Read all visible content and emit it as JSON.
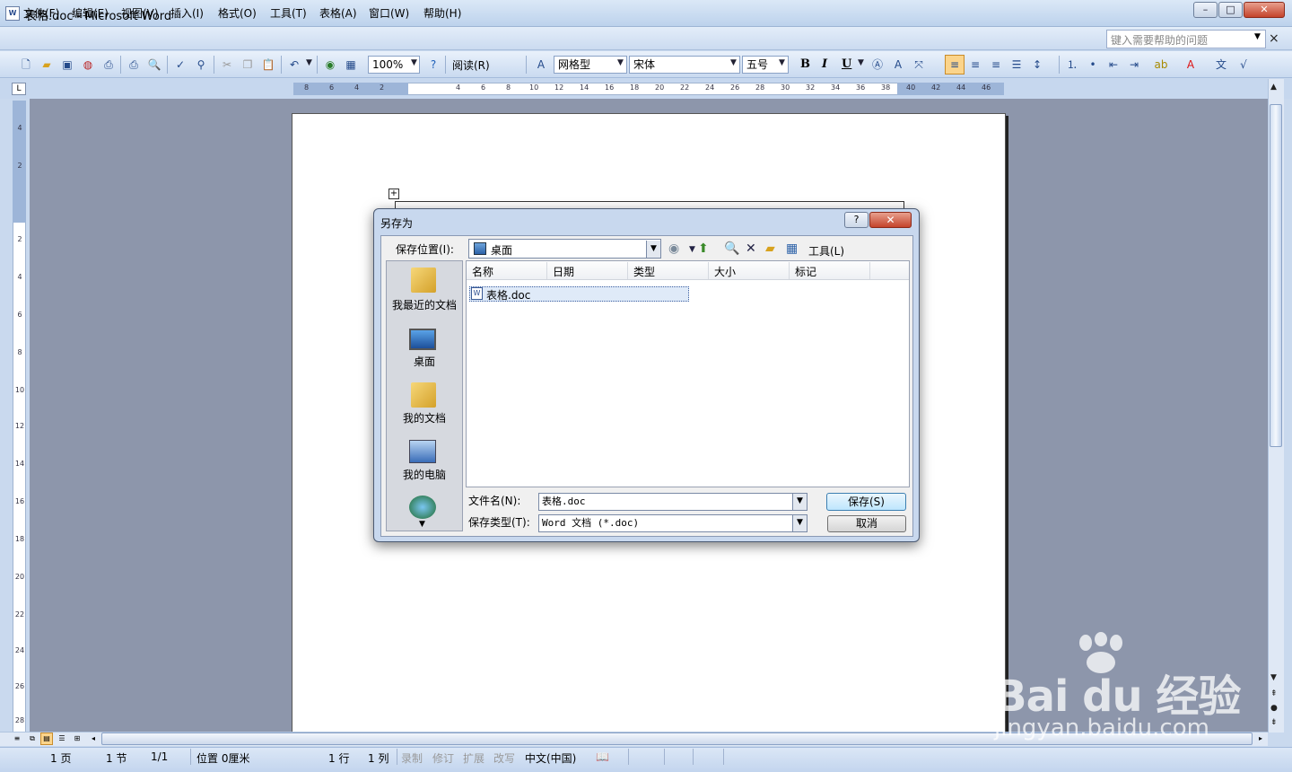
{
  "window": {
    "title": "表格.doc - Microsoft Word",
    "icon": "word-doc-icon",
    "minimize": "–",
    "maximize": "□",
    "close": "✕"
  },
  "menu": {
    "items": [
      "文件(F)",
      "编辑(E)",
      "视图(V)",
      "插入(I)",
      "格式(O)",
      "工具(T)",
      "表格(A)",
      "窗口(W)",
      "帮助(H)"
    ],
    "help_placeholder": "键入需要帮助的问题",
    "close": "×"
  },
  "toolbar": {
    "zoom": "100%",
    "read": "阅读(R)",
    "style": "网格型",
    "font": "宋体",
    "size": "五号",
    "bold": "B",
    "italic": "I",
    "underline": "U"
  },
  "ruler": {
    "h_ticks": [
      "8",
      "6",
      "4",
      "2",
      "",
      "2",
      "4",
      "6",
      "8",
      "10",
      "12",
      "14",
      "16",
      "18",
      "20",
      "22",
      "24",
      "26",
      "28",
      "30",
      "32",
      "34",
      "36",
      "38",
      "40",
      "42",
      "44",
      "46"
    ],
    "v_ticks": [
      "4",
      "2",
      "",
      "2",
      "4",
      "6",
      "8",
      "10",
      "12",
      "14",
      "16",
      "18",
      "20",
      "22",
      "24",
      "26",
      "28"
    ]
  },
  "dialog": {
    "title": "另存为",
    "help": "?",
    "close": "✕",
    "save_in_label": "保存位置(I):",
    "save_in_value": "桌面",
    "tools": "工具(L)",
    "places": [
      "我最近的文档",
      "桌面",
      "我的文档",
      "我的电脑"
    ],
    "columns": [
      "名称",
      "日期",
      "类型",
      "大小",
      "标记"
    ],
    "files": [
      {
        "name": "表格.doc"
      }
    ],
    "filename_label": "文件名(N):",
    "filename_value": "表格.doc",
    "filetype_label": "保存类型(T):",
    "filetype_value": "Word 文档 (*.doc)",
    "save_button": "保存(S)",
    "cancel_button": "取消"
  },
  "status": {
    "page": "1 页",
    "section": "1 节",
    "pages": "1/1",
    "position": "位置 0厘米",
    "line": "1 行",
    "column": "1 列",
    "rec": "录制",
    "trk": "修订",
    "ext": "扩展",
    "ovr": "改写",
    "lang": "中文(中国)"
  },
  "watermark": {
    "logo": "Bai du 经验",
    "url": "jingyan.baidu.com"
  },
  "colors": {
    "accent": "#fbd48b",
    "titlebar": "#c9d9ee",
    "workspace": "#8d96ab",
    "close_red": "#c4432b"
  }
}
